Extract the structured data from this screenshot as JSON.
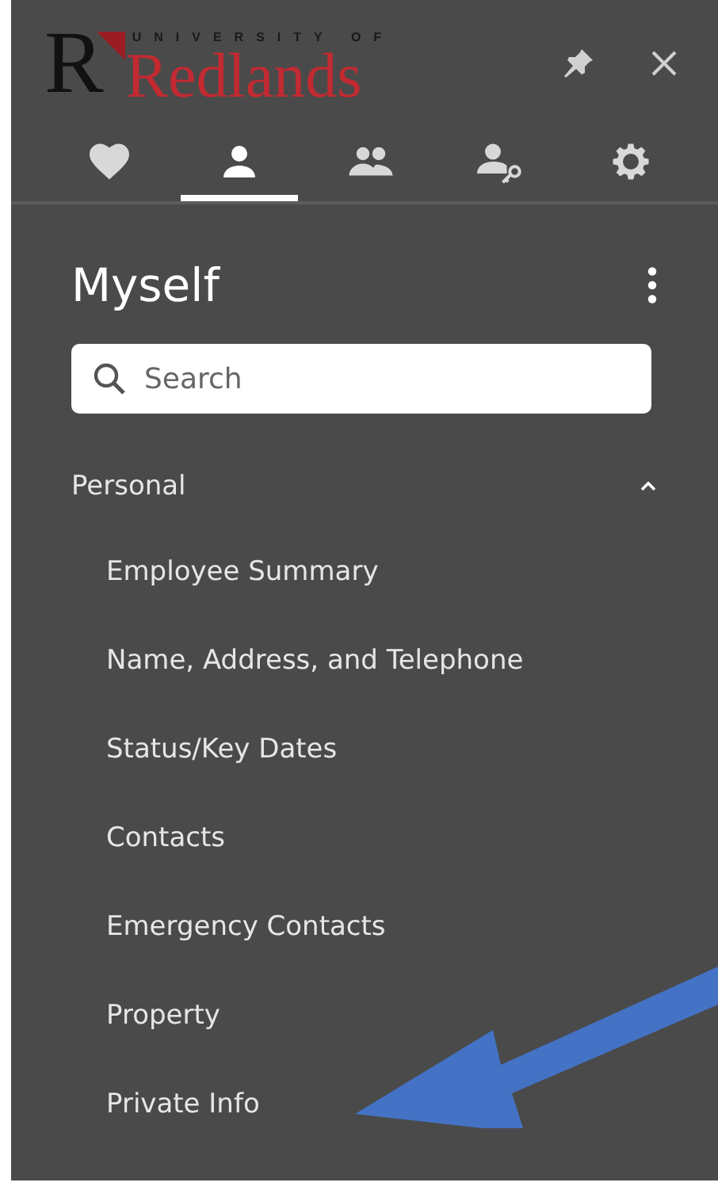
{
  "logo": {
    "letter": "R",
    "overline": "UNIVERSITY OF",
    "name": "Redlands"
  },
  "tabs": [
    {
      "selected": false
    },
    {
      "selected": true
    },
    {
      "selected": false
    },
    {
      "selected": false
    },
    {
      "selected": false
    }
  ],
  "title": "Myself",
  "search": {
    "placeholder": "Search"
  },
  "section": {
    "label": "Personal",
    "expanded": true,
    "items": [
      "Employee Summary",
      "Name, Address, and Telephone",
      "Status/Key Dates",
      "Contacts",
      "Emergency Contacts",
      "Property",
      "Private Info"
    ]
  }
}
